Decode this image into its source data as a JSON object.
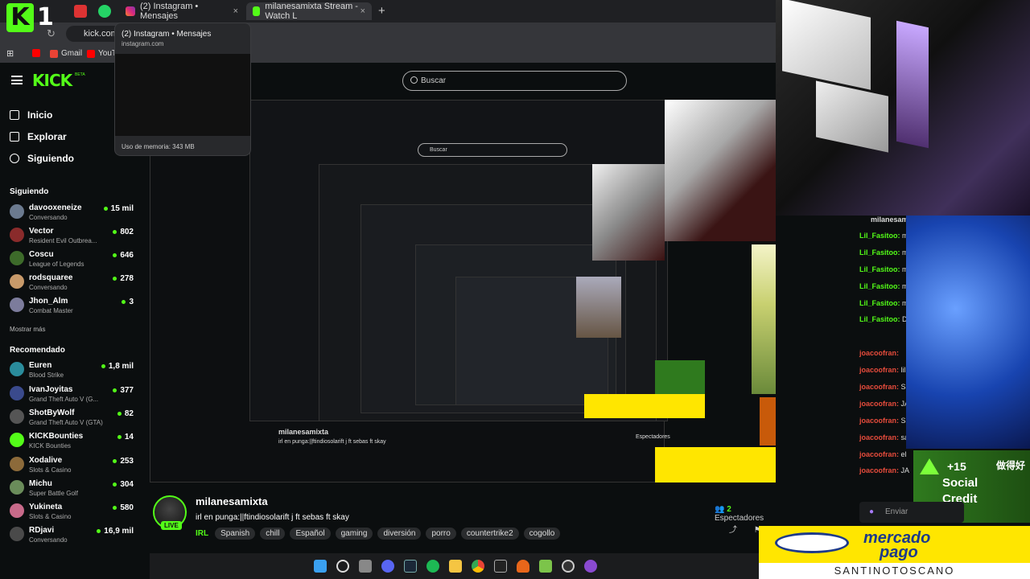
{
  "browser": {
    "tabs": [
      {
        "title": "(2) Instagram • Mensajes",
        "close": "×"
      },
      {
        "title": "milanesamixta Stream - Watch L",
        "close": "×"
      }
    ],
    "new_tab": "+",
    "url": "kick.com",
    "bookmarks": [
      "Gmail",
      "YouTu"
    ],
    "preview": {
      "title": "(2) Instagram • Mensajes",
      "url": "instagram.com",
      "memory": "Uso de memoria: 343 MB"
    }
  },
  "brand": {
    "logo": "KICK",
    "beta": "BETA",
    "overlay_logo_k": "K",
    "overlay_logo_num": "1"
  },
  "search": {
    "placeholder": "Buscar"
  },
  "nav": [
    {
      "label": "Inicio"
    },
    {
      "label": "Explorar"
    },
    {
      "label": "Siguiendo"
    }
  ],
  "following": {
    "header": "Siguiendo",
    "channels": [
      {
        "name": "davooxeneize",
        "game": "Conversando",
        "viewers": "15 mil",
        "color": "#6b7a8f"
      },
      {
        "name": "Vector",
        "game": "Resident Evil Outbrea...",
        "viewers": "802",
        "color": "#8a2b2b"
      },
      {
        "name": "Coscu",
        "game": "League of Legends",
        "viewers": "646",
        "color": "#3d6b2a"
      },
      {
        "name": "rodsquaree",
        "game": "Conversando",
        "viewers": "278",
        "color": "#c89a6a"
      },
      {
        "name": "Jhon_Alm",
        "game": "Combat Master",
        "viewers": "3",
        "color": "#7c7c9c"
      }
    ],
    "more": "Mostrar más"
  },
  "recommended": {
    "header": "Recomendado",
    "channels": [
      {
        "name": "Euren",
        "game": "Blood Strike",
        "viewers": "1,8 mil",
        "color": "#2a8c9c"
      },
      {
        "name": "IvanJoyitas",
        "game": "Grand Theft Auto V (G...",
        "viewers": "377",
        "color": "#3a4a8c"
      },
      {
        "name": "ShotByWolf",
        "game": "Grand Theft Auto V (GTA)",
        "viewers": "82",
        "color": "#555555"
      },
      {
        "name": "KICKBounties",
        "game": "KICK Bounties",
        "viewers": "14",
        "color": "#53fc18"
      },
      {
        "name": "Xodalive",
        "game": "Slots & Casino",
        "viewers": "253",
        "color": "#8c6a3a"
      },
      {
        "name": "Michu",
        "game": "Super Battle Golf",
        "viewers": "304",
        "color": "#6a8c5a"
      },
      {
        "name": "Yukineta",
        "game": "Slots & Casino",
        "viewers": "580",
        "color": "#c86a8a"
      },
      {
        "name": "RDjavi",
        "game": "Conversando",
        "viewers": "16,9 mil",
        "color": "#4a4a4a"
      }
    ]
  },
  "stream": {
    "streamer": "milanesamixta",
    "live": "LIVE",
    "title": "irl en punga:||ftindiosolarift j ft sebas ft skay",
    "category": "IRL",
    "tags": [
      "Spanish",
      "chill",
      "Español",
      "gaming",
      "diversión",
      "porro",
      "countertrike2",
      "cogollo"
    ],
    "viewers_count": "2",
    "viewers_label": "Espectadores"
  },
  "chat": {
    "channel": "milanesamixta",
    "messages": [
      {
        "user": "Lil_Fasitoo:",
        "text": "mt"
      },
      {
        "user": "Lil_Fasitoo:",
        "text": "mt"
      },
      {
        "user": "Lil_Fasitoo:",
        "text": "mt"
      },
      {
        "user": "Lil_Fasitoo:",
        "text": "mt"
      },
      {
        "user": "Lil_Fasitoo:",
        "text": "mt"
      },
      {
        "user": "Lil_Fasitoo:",
        "text": "Da"
      },
      {
        "user": "joacoofran:",
        "text": ""
      },
      {
        "user": "joacoofran:",
        "text": "lill"
      },
      {
        "user": "joacoofran:",
        "text": "Sa"
      },
      {
        "user": "joacoofran:",
        "text": "JA"
      },
      {
        "user": "joacoofran:",
        "text": "Sa"
      },
      {
        "user": "joacoofran:",
        "text": "sa"
      },
      {
        "user": "joacoofran:",
        "text": "el"
      },
      {
        "user": "joacoofran:",
        "text": "JA"
      }
    ],
    "input_placeholder": "Enviar"
  },
  "overlays": {
    "credit": {
      "plus": "+15",
      "line1": "Social",
      "line2": "Credit",
      "cn": "做得好"
    },
    "mercado_pago": {
      "line1": "mercado",
      "line2": "pago",
      "sponsor": "SANTINOTOSCANO"
    }
  }
}
